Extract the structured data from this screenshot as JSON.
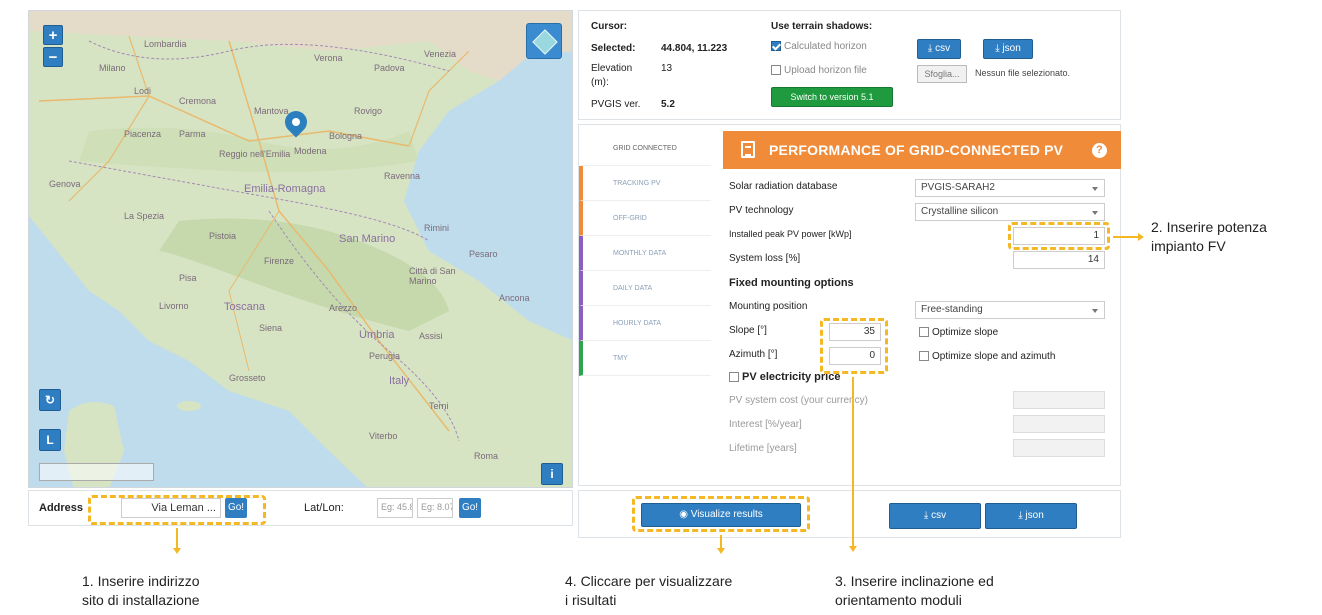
{
  "map": {
    "zoom_in": "+",
    "zoom_out": "−",
    "side_btn_1": "↻",
    "side_btn_2": "L",
    "info_btn": "i",
    "labels": [
      "Lombardia",
      "Milano",
      "Lodi",
      "Verona",
      "Padova",
      "Venezia",
      "Cremona",
      "Piacenza",
      "Parma",
      "Mantova",
      "Reggio nell'Emilia",
      "Modena",
      "Bologna",
      "Rovigo",
      "Ravenna",
      "Genova",
      "La Spezia",
      "Firenze",
      "Pistoia",
      "Livorno",
      "Pisa",
      "Siena",
      "Grosseto",
      "Perugia",
      "Terni",
      "Ancona",
      "Rimini",
      "Pesaro",
      "Arezzo",
      "Assisi",
      "Roma",
      "Viterbo"
    ],
    "big_labels": [
      "Emilia-Romagna",
      "Toscana",
      "San Marino",
      "Città di San Marino",
      "Umbria",
      "Italy"
    ]
  },
  "address": {
    "label": "Address",
    "value": "Via Leman ...",
    "go": "Go!",
    "latlon_label": "Lat/Lon:",
    "lat_placeholder": "Eg: 45.8",
    "lon_placeholder": "Eg: 8.07",
    "go2": "Go!"
  },
  "info": {
    "cursor_label": "Cursor:",
    "selected_label": "Selected:",
    "selected_value": "44.804, 11.223",
    "elevation_label": "Elevation",
    "elevation_unit": "(m):",
    "elevation_value": "13",
    "pvgis_label": "PVGIS ver.",
    "pvgis_value": "5.2",
    "terrain_label": "Use terrain shadows:",
    "calculated_horizon": "Calculated horizon",
    "upload_horizon": "Upload horizon file",
    "switch_version": "Switch to version 5.1",
    "csv": "csv",
    "json": "json",
    "browse": "Sfoglia...",
    "no_file": "Nessun file selezionato."
  },
  "tabs": [
    "Grid connected",
    "Tracking PV",
    "Off-grid",
    "Monthly data",
    "Daily data",
    "Hourly data",
    "TMY"
  ],
  "tab_colors": [
    "#ffffff",
    "#f08b3a",
    "#f08b3a",
    "#8b5fbf",
    "#8b5fbf",
    "#8b5fbf",
    "#2ea44f"
  ],
  "perf": {
    "title": "PERFORMANCE OF GRID-CONNECTED PV",
    "help": "?",
    "solar_db_label": "Solar radiation database",
    "solar_db_value": "PVGIS-SARAH2",
    "pv_tech_label": "PV technology",
    "pv_tech_value": "Crystalline silicon",
    "peak_power_label": "Installed peak PV power [kWp]",
    "peak_power_value": "1",
    "system_loss_label": "System loss [%]",
    "system_loss_value": "14",
    "fixed_mounting": "Fixed mounting options",
    "mounting_label": "Mounting position",
    "mounting_value": "Free-standing",
    "slope_label": "Slope [°]",
    "slope_value": "35",
    "azimuth_label": "Azimuth [°]",
    "azimuth_value": "0",
    "optimize_slope": "Optimize slope",
    "optimize_both": "Optimize slope and azimuth",
    "price_label": "PV electricity price",
    "cost_label": "PV system cost (your currency)",
    "interest_label": "Interest [%/year]",
    "lifetime_label": "Lifetime [years]"
  },
  "actions": {
    "visualize": "Visualize results",
    "csv": "csv",
    "json": "json"
  },
  "annotations": {
    "a1_line1": "1. Inserire indirizzo",
    "a1_line2": "sito di installazione",
    "a2_line1": "2. Inserire potenza",
    "a2_line2": "impianto FV",
    "a3_line1": "3. Inserire inclinazione ed",
    "a3_line2": "orientamento moduli",
    "a4_line1": "4. Cliccare per visualizzare",
    "a4_line2": "i risultati"
  },
  "colors": {
    "accent": "#f08b3a",
    "primary": "#2f7ec2",
    "success": "#1f9a3e",
    "annotation": "#f3b824"
  }
}
